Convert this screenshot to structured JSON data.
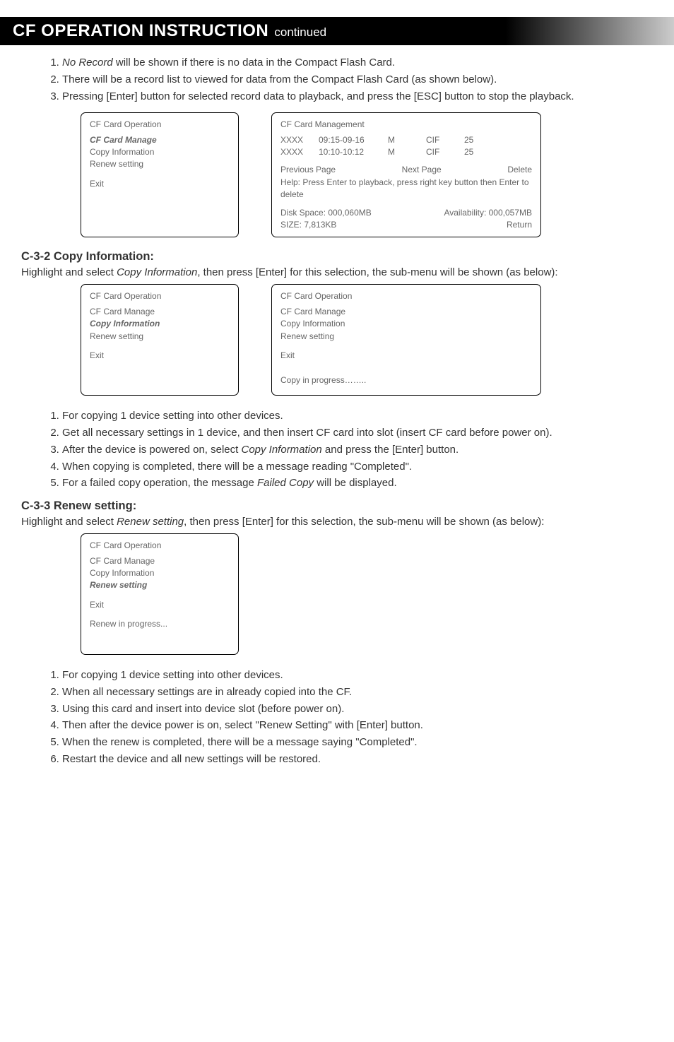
{
  "header": {
    "title": "CF OPERATION INSTRUCTION",
    "sub": "continued"
  },
  "top_list": {
    "i1_a": "No Record",
    "i1_b": " will be shown if there is no data in the Compact Flash Card.",
    "i2": "There will be a record list to viewed for data from the Compact Flash Card (as shown below).",
    "i3": "Pressing [Enter] button for selected record data to playback, and press the [ESC] button to stop the playback."
  },
  "box1_left": {
    "title": "CF Card Operation",
    "l1": "CF Card Manage",
    "l2": "Copy Information",
    "l3": "Renew setting",
    "l4": "Exit"
  },
  "box1_right": {
    "title": "CF Card Management",
    "r1_c1": "XXXX",
    "r1_c2": "09:15-09-16",
    "r1_c3": "M",
    "r1_c4": "CIF",
    "r1_c5": "25",
    "r2_c1": "XXXX",
    "r2_c2": "10:10-10:12",
    "r2_c3": "M",
    "r2_c4": "CIF",
    "r2_c5": "25",
    "pp": "Previous Page",
    "np": "Next Page",
    "del": "Delete",
    "help": "Help: Press Enter to playback, press right key button then Enter to delete",
    "disk": "Disk Space: 000,060MB",
    "avail": "Availability: 000,057MB",
    "size": "SIZE: 7,813KB",
    "ret": "Return"
  },
  "sec_c32": {
    "heading": "C-3-2 Copy Information:",
    "para_a": "Highlight and select ",
    "para_b": "Copy Information",
    "para_c": ", then press [Enter] for this selection, the sub-menu will be shown (as below):"
  },
  "box2_left": {
    "title": "CF Card Operation",
    "l1": "CF Card Manage",
    "l2": "Copy Information",
    "l3": "Renew setting",
    "l4": "Exit"
  },
  "box2_right": {
    "title": "CF Card Operation",
    "l1": "CF Card Manage",
    "l2": "Copy Information",
    "l3": "Renew setting",
    "l4": "Exit",
    "progress": "Copy in progress…….."
  },
  "sec_c32_list": {
    "i1": "For copying 1 device setting into other devices.",
    "i2": "Get all necessary settings in 1 device, and then insert CF card into slot (insert CF card before power on).",
    "i3_a": "After the device is powered on, select ",
    "i3_b": "Copy Information",
    "i3_c": " and press the [Enter] button.",
    "i4": "When copying is completed, there will be a message reading \"Completed\".",
    "i5_a": "For a failed copy operation, the message ",
    "i5_b": "Failed Copy",
    "i5_c": " will be displayed."
  },
  "sec_c33": {
    "heading": "C-3-3 Renew setting:",
    "para_a": "Highlight and select ",
    "para_b": "Renew setting",
    "para_c": ", then press [Enter] for this selection, the sub-menu will be shown (as below):"
  },
  "box3": {
    "title": "CF Card Operation",
    "l1": "CF Card Manage",
    "l2": "Copy Information",
    "l3": "Renew setting",
    "l4": "Exit",
    "progress": "Renew in progress..."
  },
  "sec_c33_list": {
    "i1": "For copying 1 device setting into other devices.",
    "i2": "When all necessary settings are in already copied into the CF.",
    "i3": "Using this card and insert into device slot (before power on).",
    "i4": "Then after the device power is on, select \"Renew Setting\" with [Enter] button.",
    "i5": "When the renew is completed, there will be a message saying \"Completed\".",
    "i6": "Restart the device and all new settings will be restored."
  }
}
